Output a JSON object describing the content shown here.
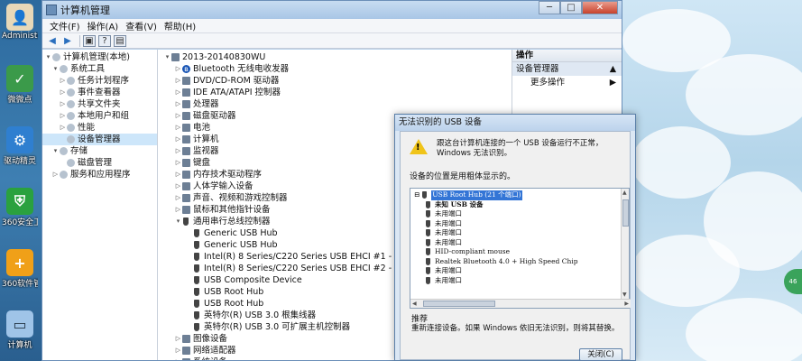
{
  "desktop": {
    "icons": [
      "Administr...",
      "微微点",
      "驱动精灵",
      "360安全卫士",
      "360软件管家",
      "计算机"
    ]
  },
  "window": {
    "title": "计算机管理",
    "buttons": {
      "min": "─",
      "max": "□",
      "close": "✕"
    },
    "menu": [
      "文件(F)",
      "操作(A)",
      "查看(V)",
      "帮助(H)"
    ]
  },
  "left_tree": [
    {
      "label": "计算机管理(本地)",
      "indent": 0,
      "arrow": "▾"
    },
    {
      "label": "系统工具",
      "indent": 1,
      "arrow": "▾"
    },
    {
      "label": "任务计划程序",
      "indent": 2,
      "arrow": "▷"
    },
    {
      "label": "事件查看器",
      "indent": 2,
      "arrow": "▷"
    },
    {
      "label": "共享文件夹",
      "indent": 2,
      "arrow": "▷"
    },
    {
      "label": "本地用户和组",
      "indent": 2,
      "arrow": "▷"
    },
    {
      "label": "性能",
      "indent": 2,
      "arrow": "▷"
    },
    {
      "label": "设备管理器",
      "indent": 2,
      "arrow": "",
      "selected": true
    },
    {
      "label": "存储",
      "indent": 1,
      "arrow": "▾"
    },
    {
      "label": "磁盘管理",
      "indent": 2,
      "arrow": ""
    },
    {
      "label": "服务和应用程序",
      "indent": 1,
      "arrow": "▷"
    }
  ],
  "device_tree": [
    {
      "label": "2013-20140830WU",
      "indent": 0,
      "arrow": "▾",
      "icon": "computer-icon"
    },
    {
      "label": "Bluetooth 无线电收发器",
      "indent": 1,
      "arrow": "▷",
      "icon": "bluetooth-icon"
    },
    {
      "label": "DVD/CD-ROM 驱动器",
      "indent": 1,
      "arrow": "▷",
      "icon": "device-icon"
    },
    {
      "label": "IDE ATA/ATAPI 控制器",
      "indent": 1,
      "arrow": "▷",
      "icon": "device-icon"
    },
    {
      "label": "处理器",
      "indent": 1,
      "arrow": "▷",
      "icon": "device-icon"
    },
    {
      "label": "磁盘驱动器",
      "indent": 1,
      "arrow": "▷",
      "icon": "device-icon"
    },
    {
      "label": "电池",
      "indent": 1,
      "arrow": "▷",
      "icon": "device-icon"
    },
    {
      "label": "计算机",
      "indent": 1,
      "arrow": "▷",
      "icon": "device-icon"
    },
    {
      "label": "监视器",
      "indent": 1,
      "arrow": "▷",
      "icon": "device-icon"
    },
    {
      "label": "键盘",
      "indent": 1,
      "arrow": "▷",
      "icon": "device-icon"
    },
    {
      "label": "内存技术驱动程序",
      "indent": 1,
      "arrow": "▷",
      "icon": "device-icon"
    },
    {
      "label": "人体学输入设备",
      "indent": 1,
      "arrow": "▷",
      "icon": "device-icon"
    },
    {
      "label": "声音、视频和游戏控制器",
      "indent": 1,
      "arrow": "▷",
      "icon": "device-icon"
    },
    {
      "label": "鼠标和其他指针设备",
      "indent": 1,
      "arrow": "▷",
      "icon": "device-icon"
    },
    {
      "label": "通用串行总线控制器",
      "indent": 1,
      "arrow": "▾",
      "icon": "usb-icon"
    },
    {
      "label": "Generic USB Hub",
      "indent": 2,
      "arrow": "",
      "icon": "usb-icon"
    },
    {
      "label": "Generic USB Hub",
      "indent": 2,
      "arrow": "",
      "icon": "usb-icon"
    },
    {
      "label": "Intel(R) 8 Series/C220 Series USB EHCI #1 - 8C26",
      "indent": 2,
      "arrow": "",
      "icon": "usb-icon"
    },
    {
      "label": "Intel(R) 8 Series/C220 Series USB EHCI #2 - 8C2D",
      "indent": 2,
      "arrow": "",
      "icon": "usb-icon"
    },
    {
      "label": "USB Composite Device",
      "indent": 2,
      "arrow": "",
      "icon": "usb-icon"
    },
    {
      "label": "USB Root Hub",
      "indent": 2,
      "arrow": "",
      "icon": "usb-icon"
    },
    {
      "label": "USB Root Hub",
      "indent": 2,
      "arrow": "",
      "icon": "usb-icon"
    },
    {
      "label": "英特尔(R) USB 3.0 根集线器",
      "indent": 2,
      "arrow": "",
      "icon": "usb-icon"
    },
    {
      "label": "英特尔(R) USB 3.0 可扩展主机控制器",
      "indent": 2,
      "arrow": "",
      "icon": "usb-icon"
    },
    {
      "label": "图像设备",
      "indent": 1,
      "arrow": "▷",
      "icon": "device-icon"
    },
    {
      "label": "网络适配器",
      "indent": 1,
      "arrow": "▷",
      "icon": "device-icon"
    },
    {
      "label": "系统设备",
      "indent": 1,
      "arrow": "▷",
      "icon": "device-icon"
    }
  ],
  "actions": {
    "header": "操作",
    "section": "设备管理器",
    "more": "更多操作"
  },
  "dialog": {
    "title": "无法识别的 USB 设备",
    "message": "跟这台计算机连接的一个 USB 设备运行不正常，Windows 无法识别。",
    "location_label": "设备的位置是用粗体显示的。",
    "tree": [
      {
        "label": "USB Root Hub (21 个端口)",
        "indent": 0,
        "bold": false,
        "highlight": true,
        "prefix": "⊟"
      },
      {
        "label": "未知 USB 设备",
        "indent": 1,
        "bold": true
      },
      {
        "label": "未用端口",
        "indent": 1
      },
      {
        "label": "未用端口",
        "indent": 1
      },
      {
        "label": "未用端口",
        "indent": 1
      },
      {
        "label": "未用端口",
        "indent": 1
      },
      {
        "label": "HID-compliant mouse",
        "indent": 1
      },
      {
        "label": "Realtek Bluetooth 4.0 + High Speed Chip",
        "indent": 1
      },
      {
        "label": "未用端口",
        "indent": 1
      },
      {
        "label": "未用端口",
        "indent": 1
      }
    ],
    "suggestion_header": "推荐",
    "suggestion": "重新连接设备。如果 Windows 依旧无法识别，则将其替换。",
    "close_button": "关闭(C)"
  },
  "badge": "46"
}
